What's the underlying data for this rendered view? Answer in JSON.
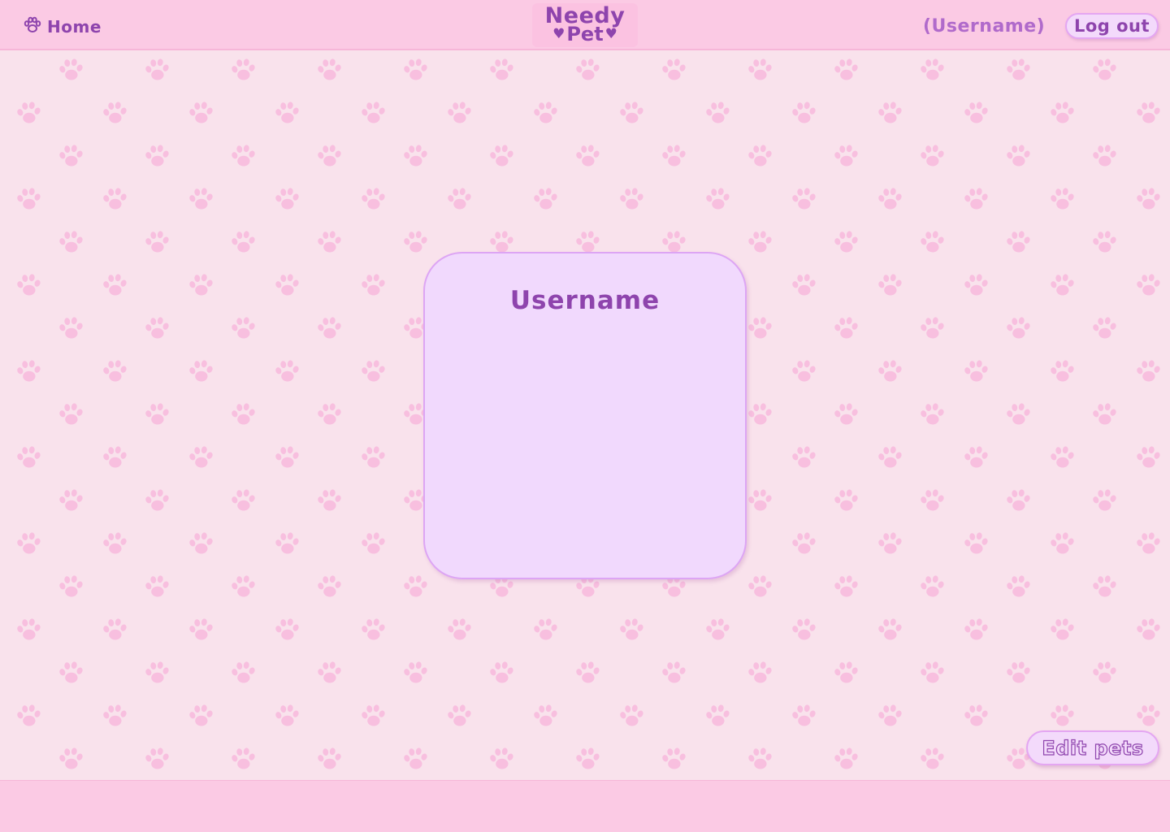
{
  "header": {
    "home_label": "Home",
    "home_icon": "paw-icon",
    "logo_line1": "Needy",
    "logo_line2": "Pet",
    "logo_heart": "♥",
    "username_display": "(Username)",
    "logout_label": "Log out"
  },
  "main": {
    "profile_card_title": "Username"
  },
  "actions": {
    "edit_pets_label": "Edit pets"
  },
  "colors": {
    "background": "#f9e2ec",
    "header_bg": "#fbcae4",
    "accent_purple": "#8e44ad",
    "card_bg": "#f1d9fd",
    "card_border": "#dda5f4",
    "paw_pattern": "#f8bfdf"
  },
  "background_pattern_icon": "paw-print-icon"
}
